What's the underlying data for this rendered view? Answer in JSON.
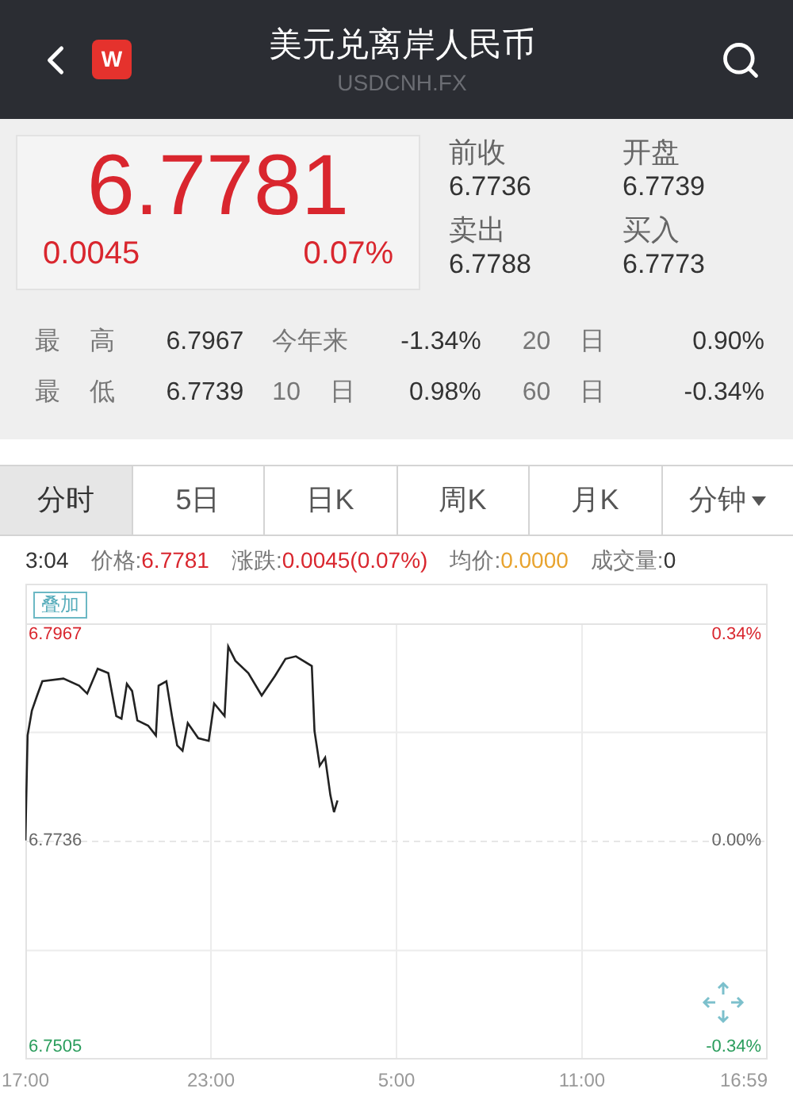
{
  "header": {
    "logo": "W",
    "title": "美元兑离岸人民币",
    "symbol": "USDCNH.FX"
  },
  "quote": {
    "price": "6.7781",
    "change": "0.0045",
    "change_pct": "0.07%",
    "fields": [
      {
        "label": "前收",
        "value": "6.7736"
      },
      {
        "label": "开盘",
        "value": "6.7739"
      },
      {
        "label": "卖出",
        "value": "6.7788"
      },
      {
        "label": "买入",
        "value": "6.7773"
      }
    ]
  },
  "stats": [
    [
      {
        "label": "最 高",
        "value": "6.7967"
      },
      {
        "label": "今年来",
        "value": "-1.34%"
      },
      {
        "label": "20 日",
        "value": "0.90%"
      }
    ],
    [
      {
        "label": "最 低",
        "value": "6.7739"
      },
      {
        "label": "10 日",
        "value": "0.98%"
      },
      {
        "label": "60 日",
        "value": "-0.34%"
      }
    ]
  ],
  "tabs": [
    {
      "label": "分时",
      "selected": true,
      "kind": "tab"
    },
    {
      "label": "5日",
      "selected": false,
      "kind": "tab"
    },
    {
      "label": "日K",
      "selected": false,
      "kind": "tab"
    },
    {
      "label": "周K",
      "selected": false,
      "kind": "tab"
    },
    {
      "label": "月K",
      "selected": false,
      "kind": "tab"
    },
    {
      "label": "分钟",
      "selected": false,
      "kind": "dropdown"
    }
  ],
  "info": {
    "time": "3:04",
    "items": [
      {
        "label": "价格:",
        "value": "6.7781",
        "color": "#d9262e"
      },
      {
        "label": "涨跌:",
        "value": "0.0045(0.07%)",
        "color": "#d9262e"
      },
      {
        "label": "均价:",
        "value": "0.0000",
        "color": "#e8a32e"
      },
      {
        "label": "成交量:",
        "value": "0",
        "color": "#333333"
      }
    ]
  },
  "chart": {
    "overlay_button": "叠加",
    "next_day_labels": [
      "5:00",
      "11:00",
      "16:59"
    ],
    "percent_labels": [
      {
        "label": "0.34%",
        "color": "#d9262e"
      },
      {
        "label": "0.00%",
        "color": "#666666"
      },
      {
        "label": "-0.34%",
        "color": "#2a9d5c"
      }
    ],
    "chart_data": {
      "type": "line",
      "xlim": [
        17,
        41
      ],
      "ylim": [
        6.7491,
        6.7981
      ],
      "ref_lines": [
        {
          "axis": "y",
          "value": 6.7736
        }
      ],
      "xticks": [
        {
          "value": 17,
          "label": "17:00"
        },
        {
          "value": 23,
          "label": "23:00"
        }
      ],
      "yticks": [
        {
          "value": 6.7967,
          "label": "6.7967"
        },
        {
          "value": 6.7736,
          "label": "6.7736"
        },
        {
          "value": 6.7505,
          "label": "6.7505"
        }
      ],
      "x": [
        17,
        17.07,
        17.21,
        17.38,
        17.55,
        18.23,
        18.74,
        19.0,
        19.34,
        19.68,
        19.94,
        20.11,
        20.28,
        20.45,
        20.62,
        20.97,
        21.22,
        21.31,
        21.56,
        21.74,
        21.91,
        22.08,
        22.25,
        22.59,
        22.93,
        23.1,
        23.44,
        23.56,
        23.79,
        24.21,
        24.64,
        25.07,
        25.41,
        25.75,
        26.26,
        26.35,
        26.52,
        26.69,
        26.86,
        26.98,
        27.09
      ],
      "series": [
        {
          "color": "#222222",
          "values": [
            6.7737,
            6.7855,
            6.7883,
            6.79,
            6.7916,
            6.7919,
            6.7911,
            6.7902,
            6.793,
            6.7925,
            6.7877,
            6.7874,
            6.7913,
            6.7905,
            6.7872,
            6.7866,
            6.7855,
            6.7911,
            6.7916,
            6.7877,
            6.7844,
            6.7838,
            6.7869,
            6.7852,
            6.7849,
            6.7891,
            6.7877,
            6.7955,
            6.7939,
            6.7925,
            6.79,
            6.7922,
            6.7941,
            6.7944,
            6.7933,
            6.786,
            6.7821,
            6.783,
            6.7788,
            6.7769,
            6.7782
          ]
        }
      ]
    }
  }
}
